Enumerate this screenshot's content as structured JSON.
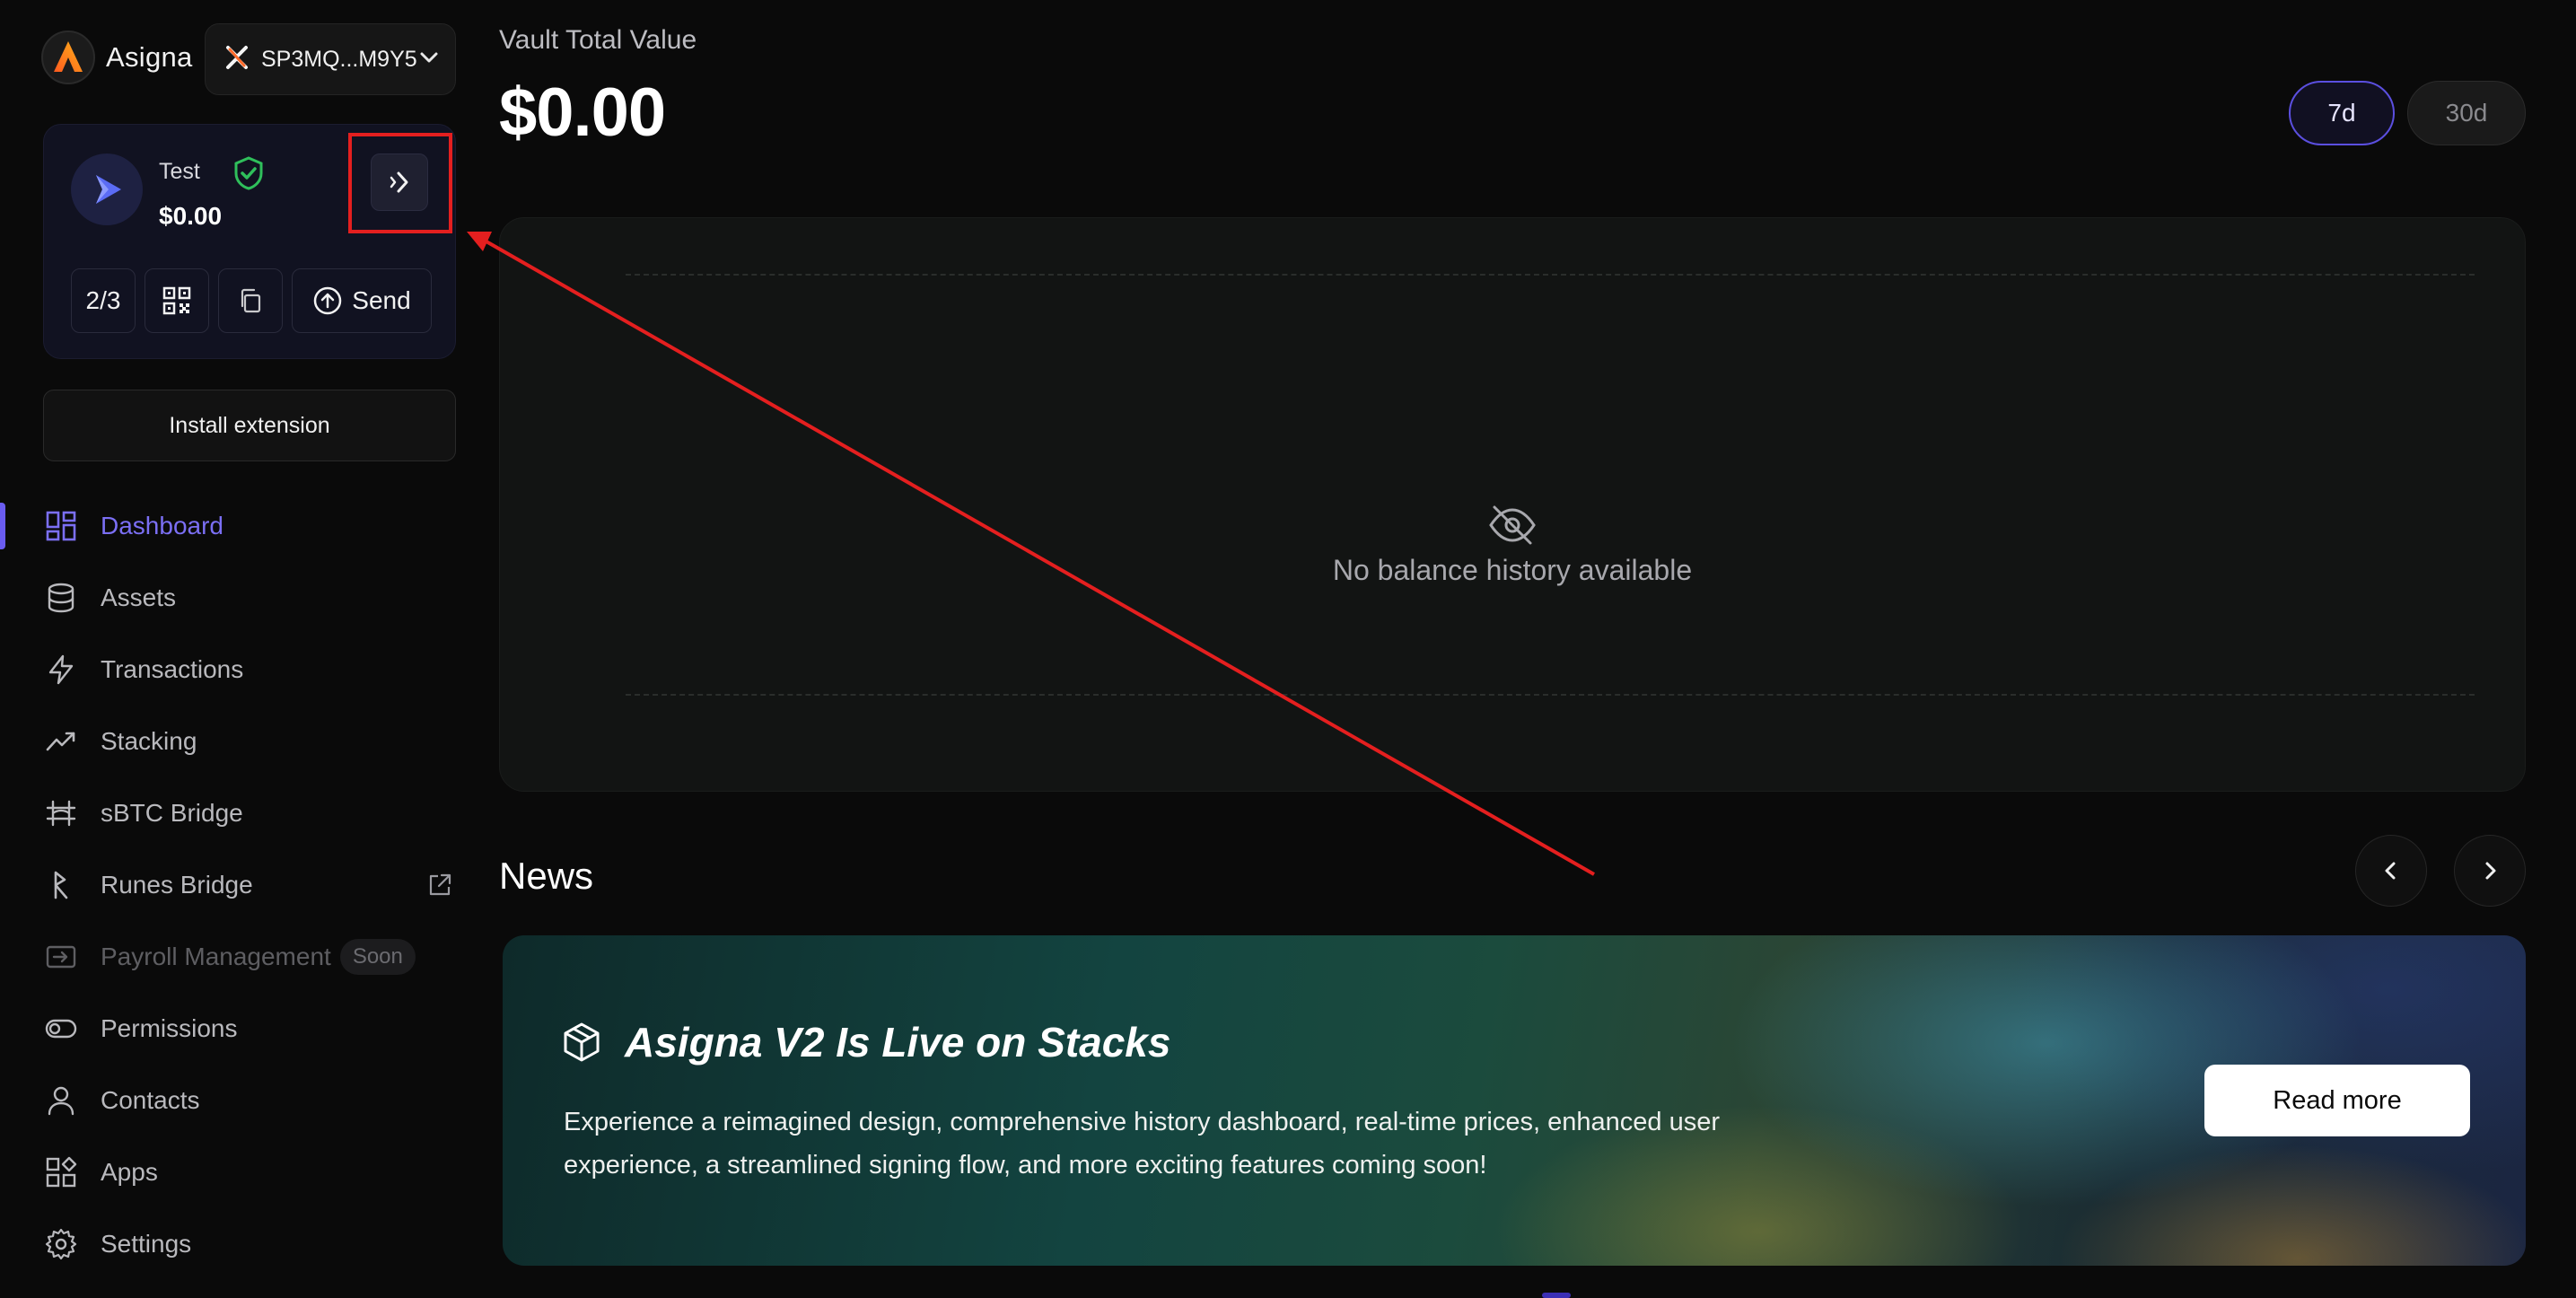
{
  "brand": {
    "name": "Asigna",
    "logo_icon": "asigna-logo-icon"
  },
  "wallet": {
    "address": "SP3MQ...M9Y5"
  },
  "vault": {
    "name": "Test",
    "balance": "$0.00",
    "threshold": "2/3",
    "send_label": "Send"
  },
  "install_label": "Install extension",
  "nav": {
    "dashboard": "Dashboard",
    "assets": "Assets",
    "transactions": "Transactions",
    "stacking": "Stacking",
    "sbtc_bridge": "sBTC Bridge",
    "runes_bridge": "Runes Bridge",
    "payroll": "Payroll Management",
    "payroll_badge": "Soon",
    "permissions": "Permissions",
    "contacts": "Contacts",
    "apps": "Apps",
    "settings": "Settings"
  },
  "summary": {
    "label": "Vault Total Value",
    "value": "$0.00",
    "ranges": [
      "7d",
      "30d"
    ],
    "selected_range": "7d"
  },
  "chart": {
    "empty_text": "No balance history available"
  },
  "news": {
    "title": "News",
    "headline": "Asigna V2 Is Live on Stacks",
    "description": "Experience a reimagined design, comprehensive history dashboard, real-time prices, enhanced user experience, a streamlined signing flow, and more exciting features coming soon!",
    "read_more": "Read more"
  },
  "colors": {
    "accent": "#6a5cf0",
    "annotation": "#e41f1f",
    "background": "#0a0a0a"
  }
}
